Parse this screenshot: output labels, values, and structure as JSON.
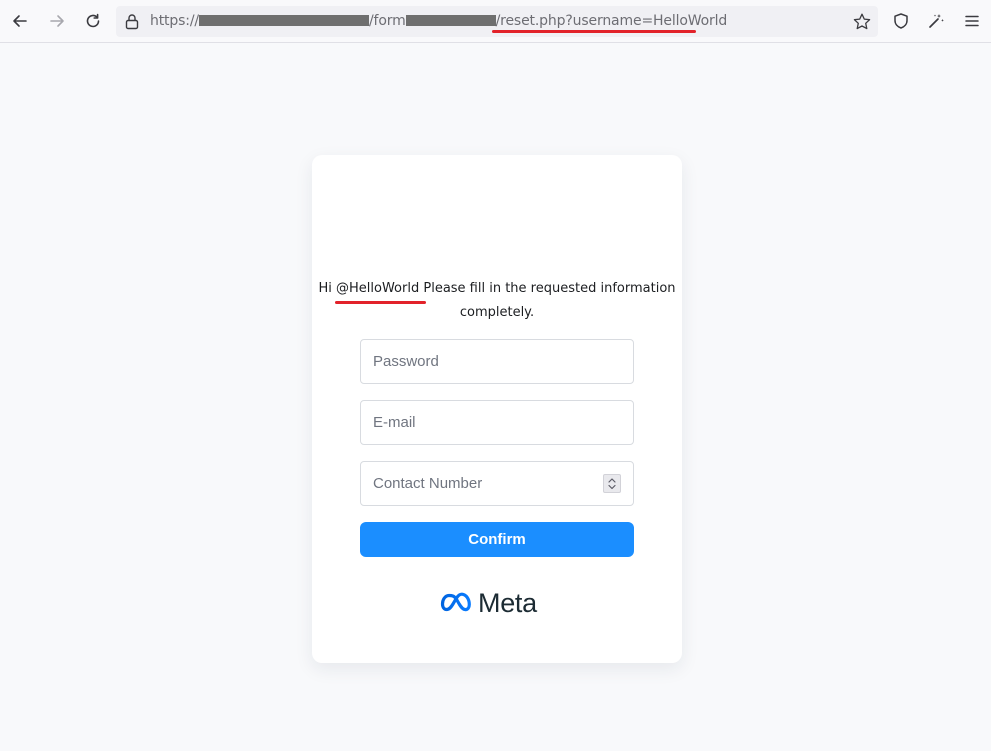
{
  "browser": {
    "url_prefix": "https://",
    "url_segment_form": "/form",
    "url_suffix": "/reset.php?username=HelloWorld",
    "icons": [
      "back-arrow-icon",
      "forward-arrow-icon",
      "reload-icon",
      "lock-icon",
      "star-icon",
      "shield-icon",
      "extensions-icon",
      "menu-icon"
    ]
  },
  "card": {
    "greeting_prefix": "Hi ",
    "greeting_handle": "@HelloWorld",
    "greeting_suffix": " Please fill in the requested information completely.",
    "fields": {
      "password_placeholder": "Password",
      "email_placeholder": "E-mail",
      "contact_placeholder": "Contact Number"
    },
    "confirm_label": "Confirm",
    "logo_text": "Meta"
  },
  "colors": {
    "button": "#1b8eff",
    "underline_annotation": "#e2222a",
    "meta_logo_blue": "#0a7cff"
  }
}
